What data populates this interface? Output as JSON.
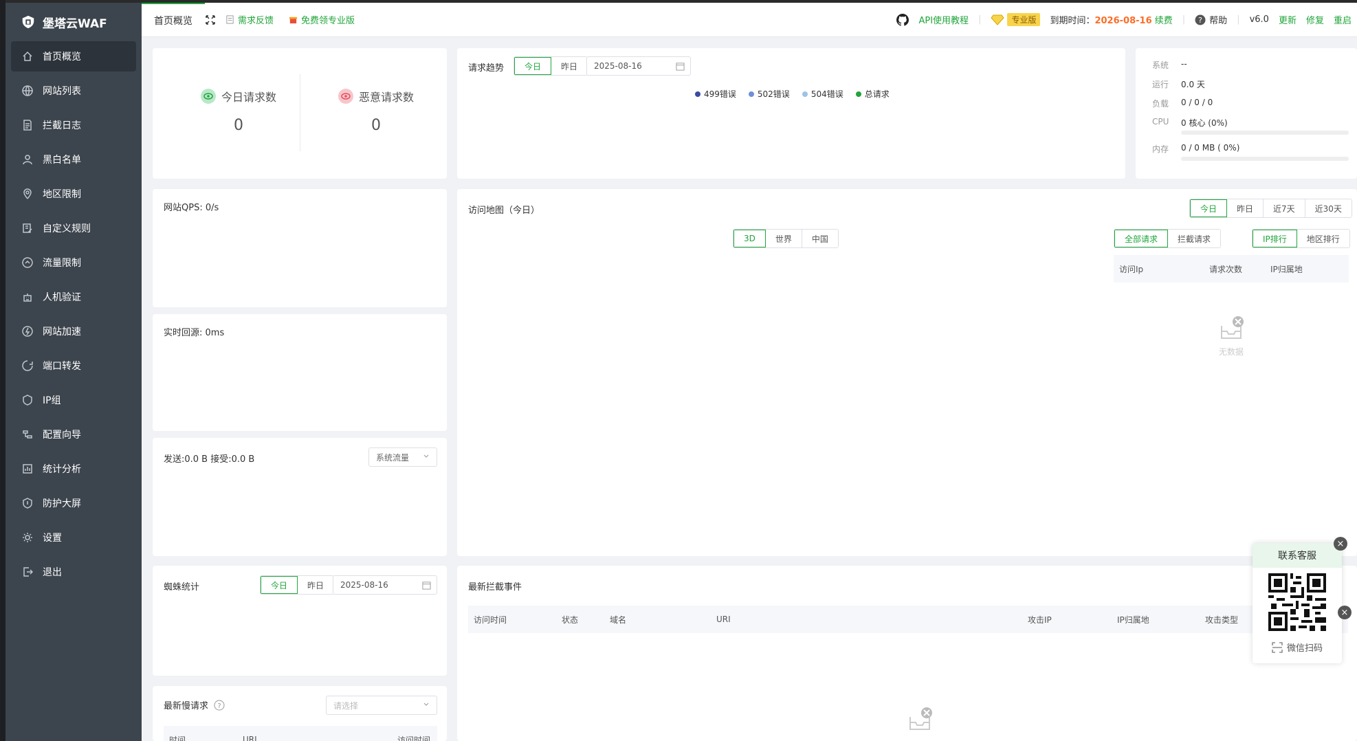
{
  "brand": {
    "name": "堡塔云WAF"
  },
  "sidebar": {
    "items": [
      {
        "label": "首页概览",
        "icon": "home-icon",
        "active": true
      },
      {
        "label": "网站列表",
        "icon": "globe-icon"
      },
      {
        "label": "拦截日志",
        "icon": "log-icon"
      },
      {
        "label": "黑白名单",
        "icon": "user-icon"
      },
      {
        "label": "地区限制",
        "icon": "location-icon"
      },
      {
        "label": "自定义规则",
        "icon": "edit-icon"
      },
      {
        "label": "流量限制",
        "icon": "traffic-icon"
      },
      {
        "label": "人机验证",
        "icon": "robot-icon"
      },
      {
        "label": "网站加速",
        "icon": "speed-icon"
      },
      {
        "label": "端口转发",
        "icon": "port-icon"
      },
      {
        "label": "IP组",
        "icon": "ipgroup-icon"
      },
      {
        "label": "配置向导",
        "icon": "wizard-icon"
      },
      {
        "label": "统计分析",
        "icon": "stats-icon"
      },
      {
        "label": "防护大屏",
        "icon": "shield-icon"
      },
      {
        "label": "设置",
        "icon": "gear-icon"
      },
      {
        "label": "退出",
        "icon": "logout-icon"
      }
    ]
  },
  "topbar": {
    "home_tab": "首页概览",
    "feedback": "需求反馈",
    "free_pro": "免费领专业版",
    "api_doc": "API使用教程",
    "edition": "专业版",
    "expire_label": "到期时间：",
    "expire_date": "2026-08-16",
    "renew": "续费",
    "help": "帮助",
    "version": "v6.0",
    "update": "更新",
    "repair": "修复",
    "restart": "重启"
  },
  "stats": {
    "today_label": "今日请求数",
    "today_value": "0",
    "malicious_label": "恶意请求数",
    "malicious_value": "0"
  },
  "trend": {
    "title": "请求趋势",
    "today": "今日",
    "yesterday": "昨日",
    "date": "2025-08-16",
    "legend": [
      {
        "label": "499错误",
        "color": "#3b4ba0"
      },
      {
        "label": "502错误",
        "color": "#6f8fd6"
      },
      {
        "label": "504错误",
        "color": "#9ec3e6"
      },
      {
        "label": "总请求",
        "color": "#20a53a"
      }
    ]
  },
  "system": {
    "os_label": "系统",
    "os_value": "--",
    "uptime_label": "运行",
    "uptime_value": "0.0 天",
    "load_label": "负载",
    "load_value": "0 / 0 / 0",
    "cpu_label": "CPU",
    "cpu_value": "0 核心 (0%)",
    "mem_label": "内存",
    "mem_value": "0 / 0 MB ( 0%)"
  },
  "qps": {
    "label": "网站QPS: 0/s"
  },
  "rt": {
    "label": "实时回源: 0ms"
  },
  "traffic": {
    "label": "发送:0.0 B  接受:0.0 B",
    "select": "系统流量"
  },
  "spider": {
    "title": "蜘蛛统计",
    "today": "今日",
    "yesterday": "昨日",
    "date": "2025-08-16"
  },
  "slow": {
    "title": "最新慢请求",
    "placeholder": "请选择",
    "cols": [
      "时间",
      "URI",
      "访问时间"
    ]
  },
  "map": {
    "title": "访问地图（今日）",
    "ranges": [
      "今日",
      "昨日",
      "近7天",
      "近30天"
    ],
    "views": [
      "3D",
      "世界",
      "中国"
    ],
    "req_types": [
      "全部请求",
      "拦截请求"
    ],
    "rank_types": [
      "IP排行",
      "地区排行"
    ],
    "cols": [
      "访问Ip",
      "请求次数",
      "IP归属地"
    ],
    "nodata": "无数据"
  },
  "events": {
    "title": "最新拦截事件",
    "cols": [
      "访问时间",
      "状态",
      "域名",
      "URI",
      "攻击IP",
      "IP归属地",
      "攻击类型"
    ]
  },
  "support": {
    "title": "联系客服",
    "wechat": "微信扫码"
  }
}
